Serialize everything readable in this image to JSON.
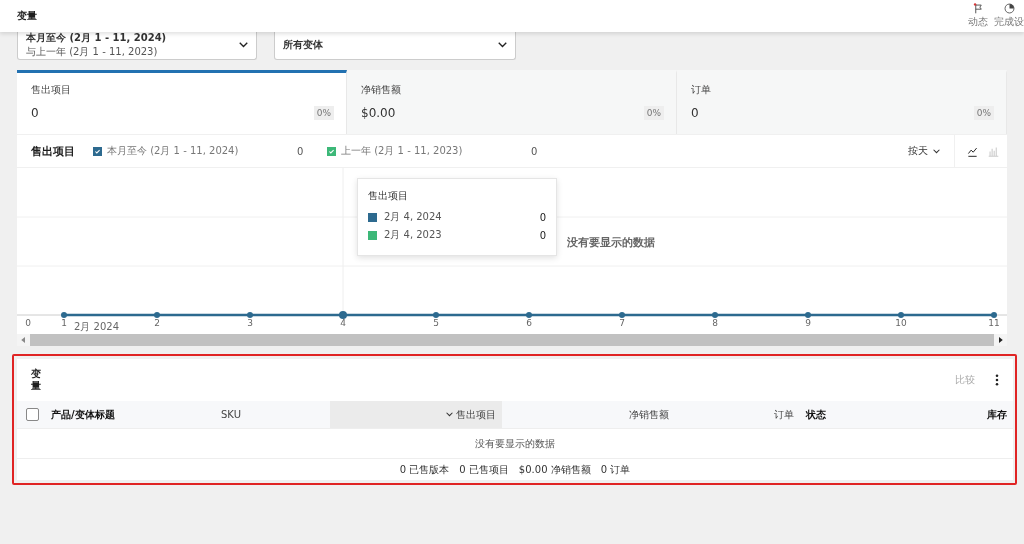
{
  "header": {
    "title": "变量",
    "actions": [
      {
        "kind": "flag",
        "label": "动态",
        "alert": true
      },
      {
        "kind": "progress",
        "label": "完成设"
      }
    ]
  },
  "filters": {
    "date": {
      "primary": "本月至今 (2月 1 - 11, 2024)",
      "secondary": "与上一年 (2月 1 - 11, 2023)"
    },
    "variant": "所有变体"
  },
  "stats": [
    {
      "label": "售出项目",
      "value": "0",
      "delta": "0%",
      "selected": true
    },
    {
      "label": "净销售额",
      "value": "$0.00",
      "delta": "0%",
      "selected": false
    },
    {
      "label": "订单",
      "value": "0",
      "delta": "0%",
      "selected": false
    }
  ],
  "chart": {
    "title": "售出项目",
    "legend": [
      {
        "label": "本月至今 (2月 1 - 11, 2024)",
        "value": "0",
        "checked": true,
        "color": "#2d6a8f"
      },
      {
        "label": "上一年 (2月 1 - 11, 2023)",
        "value": "0",
        "checked": true,
        "color": "#3cb878"
      }
    ],
    "interval": "按天",
    "views": [
      {
        "kind": "line",
        "selected": true
      },
      {
        "kind": "bar",
        "selected": false
      }
    ],
    "empty_text": "没有要显示的数据",
    "axis_note": "2月 2024",
    "tooltip": {
      "title": "售出项目",
      "rows": [
        {
          "label": "2月 4, 2024",
          "value": "0",
          "color": "#2d6a8f"
        },
        {
          "label": "2月 4, 2023",
          "value": "0",
          "color": "#3cb878"
        }
      ]
    },
    "x_labels": [
      "0",
      "1",
      "2",
      "3",
      "4",
      "5",
      "6",
      "7",
      "8",
      "9",
      "10",
      "11"
    ]
  },
  "table": {
    "title": "变量",
    "compare": "比较",
    "select_all": false,
    "columns": [
      {
        "label": "产品/变体标题",
        "bold": true,
        "sorted": false
      },
      {
        "label": "SKU",
        "bold": false,
        "sorted": false
      },
      {
        "label": "售出项目",
        "bold": false,
        "sorted": true
      },
      {
        "label": "净销售额",
        "bold": false,
        "sorted": false
      },
      {
        "label": "订单",
        "bold": false,
        "sorted": false
      },
      {
        "label": "状态",
        "bold": true,
        "sorted": false
      },
      {
        "label": "库存",
        "bold": true,
        "sorted": false
      }
    ],
    "empty_text": "没有要显示的数据",
    "summary": [
      "0 已售版本",
      "0 已售项目",
      "$0.00 净销售额",
      "0 订单"
    ]
  }
}
